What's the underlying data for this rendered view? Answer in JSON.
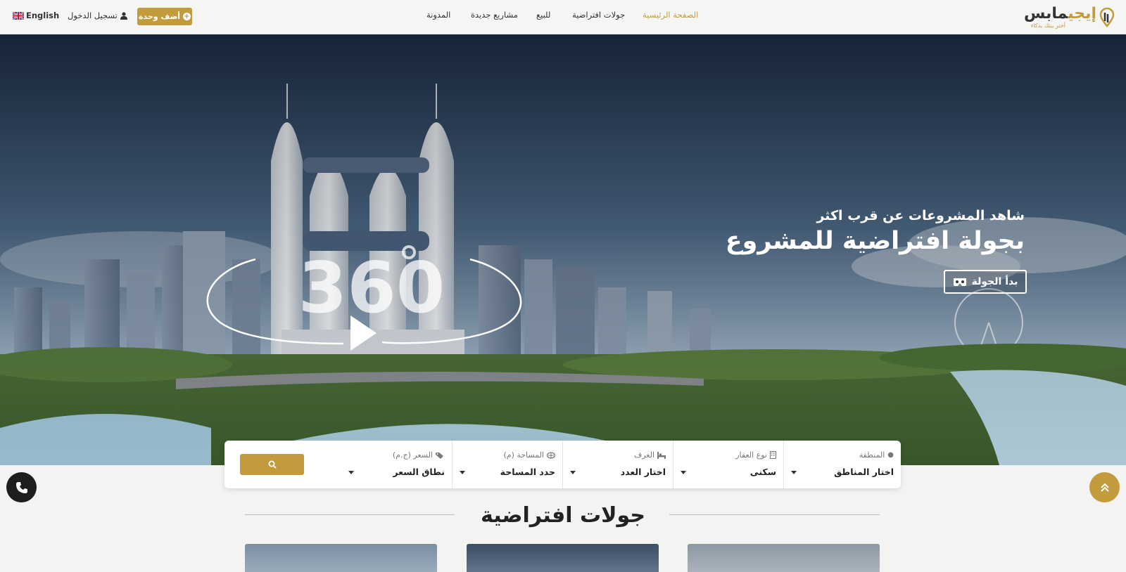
{
  "brand": {
    "name_gold": "إيجي",
    "name_dark": "مابس",
    "tagline": "أختر بيتك بذكاء"
  },
  "nav": {
    "items": [
      {
        "label": "الصفحة الرئيسية",
        "active": true
      },
      {
        "label": "جولات افتراضية",
        "active": false
      },
      {
        "label": "للبيع",
        "active": false
      },
      {
        "label": "مشاريع جديدة",
        "active": false
      },
      {
        "label": "المدونة",
        "active": false
      }
    ]
  },
  "header": {
    "add_unit_label": "أضف وحدة",
    "login_label": "تسجيل الدخول",
    "language_label": "English"
  },
  "hero": {
    "subtitle": "شاهد المشروعات عن قرب اكثر",
    "title": "بجولة افتراضية للمشروع",
    "tour_button": "بدأ الجولة",
    "badge_360": "360"
  },
  "search": {
    "fields": [
      {
        "label": "المنطقة",
        "value": "اختار المناطق",
        "icon": "map-pin-icon"
      },
      {
        "label": "نوع العقار",
        "value": "سكنى",
        "icon": "building-icon"
      },
      {
        "label": "الغرف",
        "value": "اختار العدد",
        "icon": "bed-icon"
      },
      {
        "label": "المساحة (م)",
        "value": "حدد المساحة",
        "icon": "area-icon"
      },
      {
        "label": "السعر (ج.م)",
        "value": "نطاق السعر",
        "icon": "tags-icon"
      }
    ],
    "button_icon": "search-icon"
  },
  "section": {
    "title": "جولات افتراضية"
  },
  "colors": {
    "accent": "#c39b3d",
    "dark": "#1e1e1e",
    "header_bg": "#f5f5f3"
  }
}
